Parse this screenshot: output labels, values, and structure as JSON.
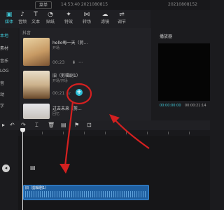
{
  "app": {
    "brand": "",
    "menu_label": "菜单",
    "title_time": "14:53:40 2021080815",
    "title_right": "20210808152"
  },
  "toolbar": {
    "tools": [
      {
        "label": "媒体",
        "icon": "▣"
      },
      {
        "label": "音频",
        "icon": "♪"
      },
      {
        "label": "文本",
        "icon": "T"
      },
      {
        "label": "贴纸",
        "icon": "◔"
      },
      {
        "label": "特效",
        "icon": "✦"
      },
      {
        "label": "转场",
        "icon": "⋈"
      },
      {
        "label": "滤镜",
        "icon": "☁"
      },
      {
        "label": "调节",
        "icon": "⇌"
      }
    ]
  },
  "leftnav": {
    "items": [
      "本地",
      "素材",
      "音乐",
      "LOG",
      "音",
      "动",
      "字"
    ]
  },
  "media": {
    "folder": "抖音",
    "clips": [
      {
        "title": "hello每一天（剪...",
        "sub": "开场",
        "duration": "00:23"
      },
      {
        "title": "旧（剪辑剧1）",
        "sub": "开场/开场",
        "duration": "00:21"
      },
      {
        "title": "过去未来（剪...",
        "sub": "回忆",
        "duration": ""
      }
    ],
    "add_label": "+"
  },
  "player": {
    "header": "播放器",
    "current": "00:00:00:00",
    "total": "00:00:21:14"
  },
  "timeline": {
    "clip_label": "旧（剪辑剧1）"
  },
  "colors": {
    "accent": "#3fc7d6",
    "clip": "#1f5fa0",
    "annotation": "#d42020"
  },
  "icons": [
    "undo-icon",
    "redo-icon",
    "split-icon",
    "delete-icon",
    "freeze-icon",
    "flag-icon",
    "audio-toggle-icon",
    "video-track-icon",
    "add-icon"
  ]
}
